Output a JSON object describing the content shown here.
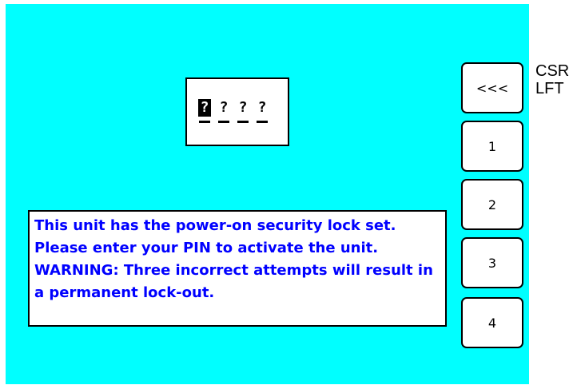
{
  "pin": {
    "digits": [
      "?",
      "?",
      "?",
      "?"
    ]
  },
  "message": {
    "text": "This unit has the power-on security lock set. Please enter your PIN to activate the unit. WARNING: Three incorrect attempts will result in a permanent lock-out."
  },
  "keys": {
    "cursor_left": {
      "label": "<<<",
      "side_label_line1": "CSR",
      "side_label_line2": "LFT"
    },
    "one": "1",
    "two": "2",
    "three": "3",
    "four": "4"
  },
  "colors": {
    "screen_background": "#00ffff",
    "message_text": "#0000ff"
  }
}
